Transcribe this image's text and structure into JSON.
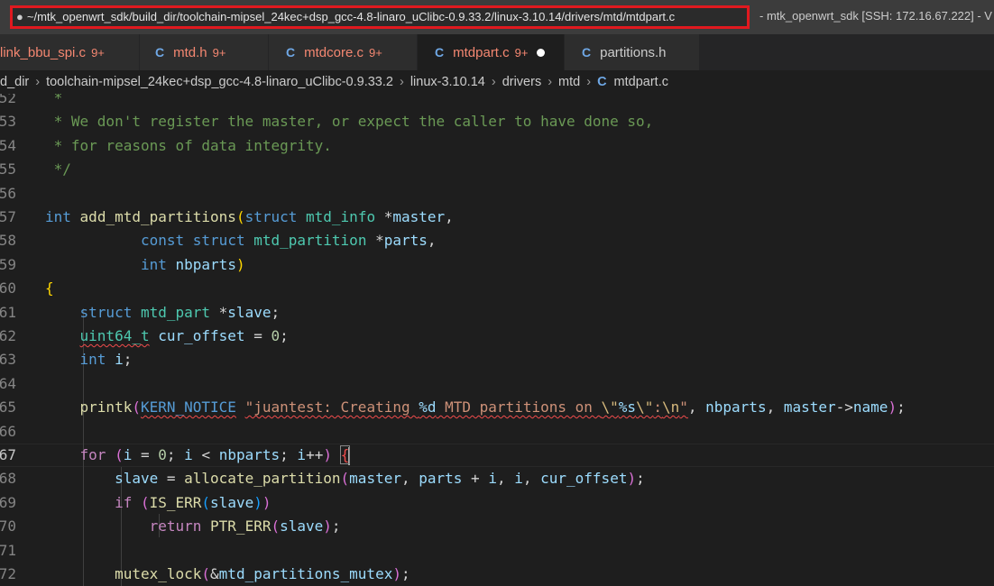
{
  "title": {
    "modified_dot": "●",
    "path": "~/mtk_openwrt_sdk/build_dir/toolchain-mipsel_24kec+dsp_gcc-4.8-linaro_uClibc-0.9.33.2/linux-3.10.14/drivers/mtd/mtdpart.c",
    "suffix": "- mtk_openwrt_sdk [SSH: 172.16.67.222] - V"
  },
  "tabs": [
    {
      "icon": "",
      "name": "link_bbu_spi.c",
      "badge": "9+"
    },
    {
      "icon": "C",
      "name": "mtd.h",
      "badge": "9+"
    },
    {
      "icon": "C",
      "name": "mtdcore.c",
      "badge": "9+"
    },
    {
      "icon": "C",
      "name": "mtdpart.c",
      "badge": "9+"
    },
    {
      "icon": "C",
      "name": "partitions.h",
      "badge": ""
    }
  ],
  "breadcrumb": {
    "items": [
      "d_dir",
      "toolchain-mipsel_24kec+dsp_gcc-4.8-linaro_uClibc-0.9.33.2",
      "linux-3.10.14",
      "drivers",
      "mtd"
    ],
    "file_icon": "C",
    "file": "mtdpart.c"
  },
  "line_numbers": [
    "52",
    "53",
    "54",
    "55",
    "56",
    "57",
    "58",
    "59",
    "60",
    "61",
    "62",
    "63",
    "64",
    "65",
    "66",
    "67",
    "68",
    "69",
    "70",
    "71",
    "72"
  ]
}
